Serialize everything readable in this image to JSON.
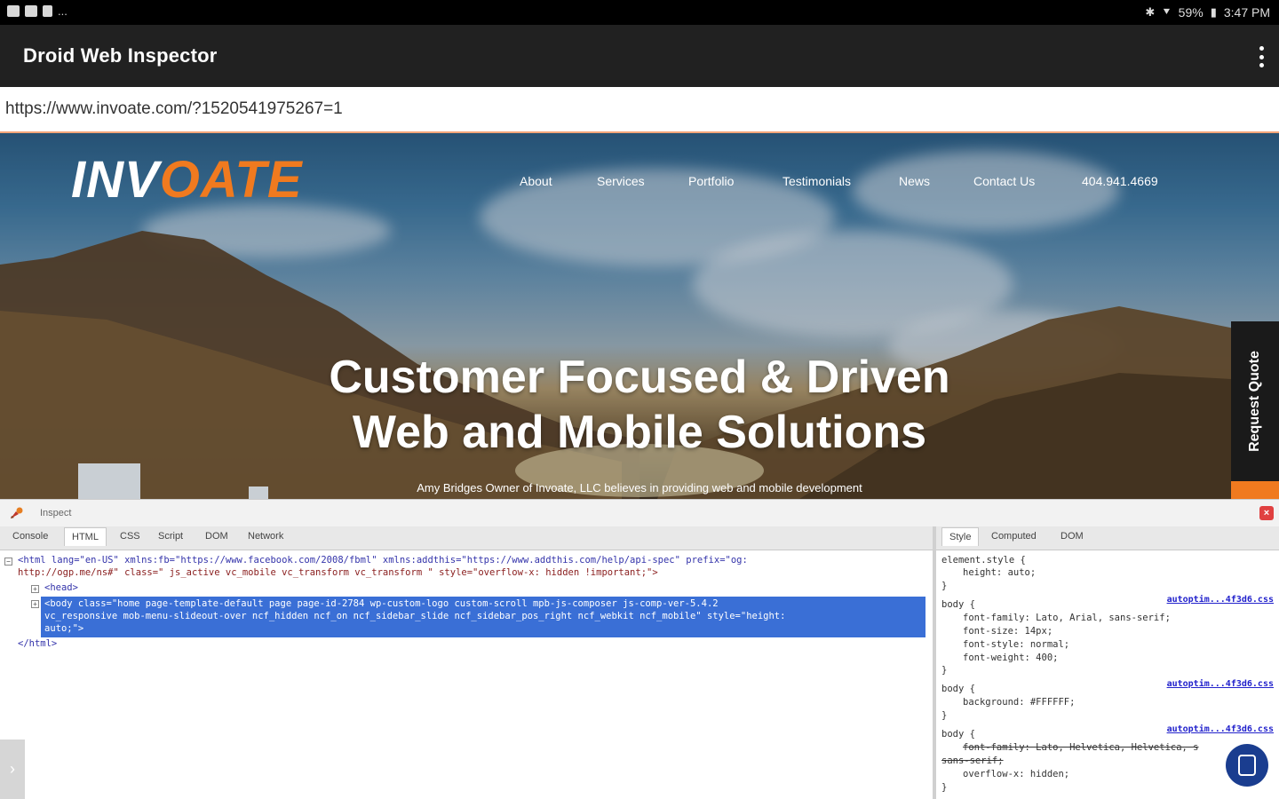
{
  "status_bar": {
    "battery": "59%",
    "time": "3:47 PM",
    "left_icons": [
      "image-icon",
      "gallery-icon",
      "notification-icon"
    ],
    "more": "..."
  },
  "app_bar": {
    "title": "Droid Web Inspector"
  },
  "url_bar": {
    "value": "https://www.invoate.com/?1520541975267=1"
  },
  "site": {
    "logo": {
      "prefix": "INV",
      "o": "O",
      "suffix": "ATE"
    },
    "nav": [
      "About",
      "Services",
      "Portfolio",
      "Testimonials",
      "News",
      "Contact Us",
      "404.941.4669"
    ],
    "headline_line1": "Customer Focused & Driven",
    "headline_line2": "Web and Mobile Solutions",
    "subline": "Amy Bridges Owner of Invoate, LLC believes in providing web and mobile development",
    "request_quote": "Request Quote"
  },
  "devtools": {
    "inspect_label": "Inspect",
    "tabs": [
      "Console",
      "HTML",
      "CSS",
      "Script",
      "DOM",
      "Network"
    ],
    "active_tab": "HTML",
    "html_lines": {
      "html_open": "<html lang=\"en-US\" xmlns:fb=\"https://www.facebook.com/2008/fbml\" xmlns:addthis=\"https://www.addthis.com/help/api-spec\" prefix=\"og:",
      "html_open_2": "http://ogp.me/ns#\" class=\" js_active vc_mobile vc_transform vc_transform \" style=\"overflow-x: hidden !important;\">",
      "head": "<head>",
      "body_1": "<body class=\"home page-template-default page page-id-2784 wp-custom-logo custom-scroll mpb-js-composer js-comp-ver-5.4.2",
      "body_2": "vc_responsive mob-menu-slideout-over ncf_hidden ncf_on ncf_sidebar_slide ncf_sidebar_pos_right ncf_webkit ncf_mobile\" style=\"height:",
      "body_3": "auto;\">",
      "html_close": "</html>"
    },
    "style_tabs": [
      "Style",
      "Computed",
      "DOM"
    ],
    "active_style_tab": "Style",
    "style_rules": {
      "r1_sel": "element.style {",
      "r1_p1": "height: auto;",
      "close": "}",
      "r2_sel": "body {",
      "r2_src": "autoptim...4f3d6.css",
      "r2_p1": "font-family: Lato, Arial, sans-serif;",
      "r2_p2": "font-size: 14px;",
      "r2_p3": "font-style: normal;",
      "r2_p4": "font-weight: 400;",
      "r3_sel": "body {",
      "r3_src": "autoptim...4f3d6.css",
      "r3_p1": "background: #FFFFFF;",
      "r4_sel": "body {",
      "r4_src": "autoptim...4f3d6.css",
      "r4_p1": "font-family: Lato, Helvetica, Helvetica, s",
      "r4_p1b": "sans-serif;",
      "r4_p2": "overflow-x: hidden;"
    }
  },
  "colors": {
    "accent": "#f07a1f",
    "selection": "#3a6fd6",
    "fab": "#1a3d8f"
  }
}
